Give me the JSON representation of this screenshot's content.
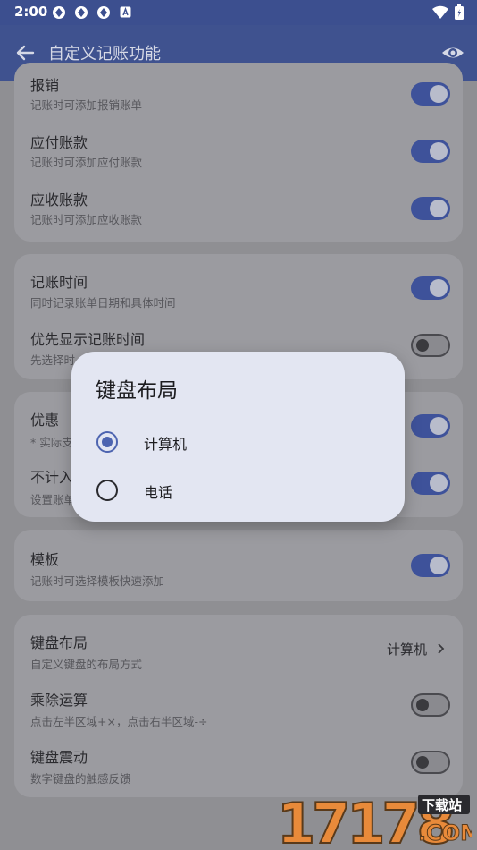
{
  "status_bar": {
    "time": "2:00"
  },
  "app_bar": {
    "title": "自定义记账功能"
  },
  "cards": [
    {
      "rows": [
        {
          "title": "报销",
          "subtitle": "记账时可添加报销账单",
          "switch": "on"
        },
        {
          "title": "应付账款",
          "subtitle": "记账时可添加应付账款",
          "switch": "on"
        },
        {
          "title": "应收账款",
          "subtitle": "记账时可添加应收账款",
          "switch": "on"
        }
      ]
    },
    {
      "rows": [
        {
          "title": "记账时间",
          "subtitle": "同时记录账单日期和具体时间",
          "switch": "on"
        },
        {
          "title": "优先显示记账时间",
          "subtitle": "先选择时",
          "switch": "off"
        }
      ]
    },
    {
      "rows": [
        {
          "title": "优惠",
          "subtitle": "* 实际支",
          "switch": "on"
        },
        {
          "title": "不计入",
          "subtitle": "设置账单",
          "switch": "on"
        }
      ]
    },
    {
      "rows": [
        {
          "title": "模板",
          "subtitle": "记账时可选择模板快速添加",
          "switch": "on"
        }
      ]
    },
    {
      "rows": [
        {
          "title": "键盘布局",
          "subtitle": "自定义键盘的布局方式",
          "value": "计算机"
        },
        {
          "title": "乘除运算",
          "subtitle": "点击左半区域+×，点击右半区域-÷",
          "switch": "off"
        },
        {
          "title": "键盘震动",
          "subtitle": "数字键盘的触感反馈",
          "switch": "off"
        }
      ]
    }
  ],
  "dialog": {
    "title": "键盘布局",
    "options": [
      {
        "label": "计算机",
        "selected": true
      },
      {
        "label": "电话",
        "selected": false
      }
    ]
  },
  "watermark": {
    "text": "17178",
    "tag": "下载站",
    "domain": ".COM"
  },
  "colors": {
    "primary": "#3f528f",
    "switch_on": "#3e529a",
    "dialog_bg": "#e3e6f2",
    "radio_accent": "#4d64b0"
  }
}
